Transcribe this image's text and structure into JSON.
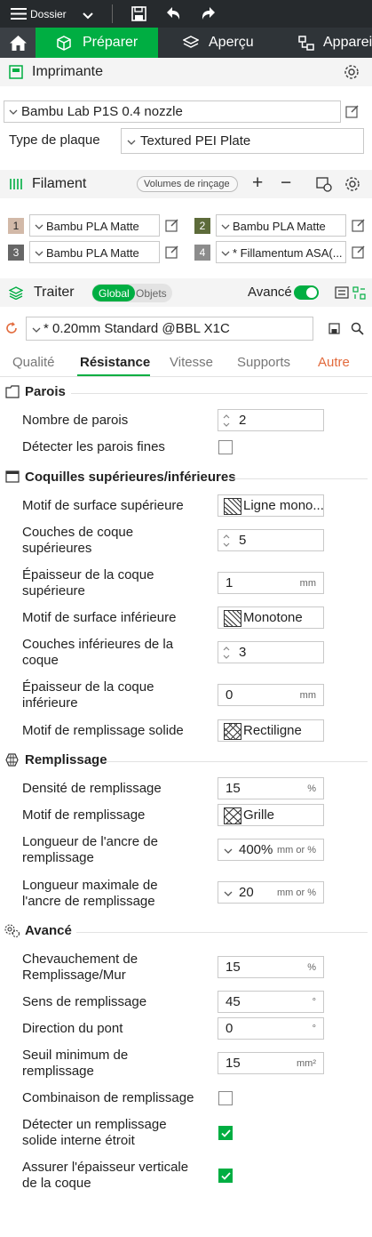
{
  "topbar": {
    "menu_label": "Dossier"
  },
  "nav": {
    "tabs": [
      {
        "label": "Préparer"
      },
      {
        "label": "Aperçu"
      },
      {
        "label": "Appareil"
      }
    ]
  },
  "printer": {
    "section_title": "Imprimante",
    "name": "Bambu Lab P1S 0.4 nozzle",
    "plate_label": "Type de plaque",
    "plate_value": "Textured PEI Plate"
  },
  "filament": {
    "section_title": "Filament",
    "flush_button": "Volumes de rinçage",
    "slots": [
      {
        "num": "1",
        "color": "#d2b9a8",
        "name": "Bambu PLA Matte"
      },
      {
        "num": "2",
        "color": "#5d6b3a",
        "name": "Bambu PLA Matte"
      },
      {
        "num": "3",
        "color": "#666666",
        "name": "Bambu PLA Matte"
      },
      {
        "num": "4",
        "color": "#8c8c8c",
        "name": "* Fillamentum ASA(..."
      }
    ]
  },
  "process": {
    "section_title": "Traiter",
    "toggle_global": "Global",
    "toggle_objects": "Objets",
    "advanced_label": "Avancé",
    "preset": "* 0.20mm Standard @BBL X1C",
    "tabs": [
      "Qualité",
      "Résistance",
      "Vitesse",
      "Supports",
      "Autre"
    ]
  },
  "groups": {
    "walls": {
      "title": "Parois",
      "wall_count_label": "Nombre de parois",
      "wall_count_value": "2",
      "thin_walls_label": "Détecter les parois fines"
    },
    "shells": {
      "title": "Coquilles supérieures/inférieures",
      "top_pattern_label": "Motif de surface supérieure",
      "top_pattern_value": "Ligne mono...",
      "top_layers_label_1": "Couches de coque",
      "top_layers_label_2": "supérieures",
      "top_layers_value": "5",
      "top_thick_label_1": "Épaisseur de la coque",
      "top_thick_label_2": "supérieure",
      "top_thick_value": "1",
      "top_thick_unit": "mm",
      "bottom_pattern_label": "Motif de surface inférieure",
      "bottom_pattern_value": "Monotone",
      "bottom_layers_label_1": "Couches inférieures de la",
      "bottom_layers_label_2": "coque",
      "bottom_layers_value": "3",
      "bottom_thick_label_1": "Épaisseur de la coque",
      "bottom_thick_label_2": "inférieure",
      "bottom_thick_value": "0",
      "bottom_thick_unit": "mm",
      "solid_pattern_label": "Motif de remplissage solide",
      "solid_pattern_value": "Rectiligne"
    },
    "infill": {
      "title": "Remplissage",
      "density_label": "Densité de remplissage",
      "density_value": "15",
      "density_unit": "%",
      "pattern_label": "Motif de remplissage",
      "pattern_value": "Grille",
      "anchor_label_1": "Longueur de l'ancre de",
      "anchor_label_2": "remplissage",
      "anchor_value": "400%",
      "anchor_unit": "mm or %",
      "anchor_max_label_1": "Longueur maximale de",
      "anchor_max_label_2": "l'ancre de remplissage",
      "anchor_max_value": "20",
      "anchor_max_unit": "mm or %"
    },
    "advanced": {
      "title": "Avancé",
      "overlap_label_1": "Chevauchement de",
      "overlap_label_2": "Remplissage/Mur",
      "overlap_value": "15",
      "overlap_unit": "%",
      "direction_label": "Sens de remplissage",
      "direction_value": "45",
      "direction_unit": "°",
      "bridge_label": "Direction du pont",
      "bridge_value": "0",
      "bridge_unit": "°",
      "min_area_label_1": "Seuil minimum de",
      "min_area_label_2": "remplissage",
      "min_area_value": "15",
      "min_area_unit": "mm²",
      "combine_label": "Combinaison de remplissage",
      "narrow_label_1": "Détecter un remplissage",
      "narrow_label_2": "solide interne étroit",
      "vshell_label_1": "Assurer l'épaisseur verticale",
      "vshell_label_2": "de la coque"
    }
  },
  "colors": {
    "accent": "#00ae42",
    "tab_active_underline": "#00ae42",
    "tab_other": "#e26a3c",
    "topbar": "#262a2d",
    "navbar": "#2f3438"
  }
}
